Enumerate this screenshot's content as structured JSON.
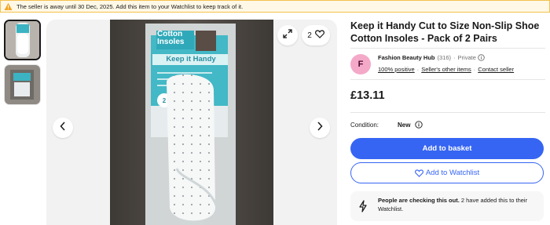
{
  "notice": {
    "text": "The seller is away until 30 Dec, 2025. Add this item to your Watchlist to keep track of it.",
    "icon": "warning-icon",
    "border_color": "#f5c14f",
    "background_color": "#fff8e6"
  },
  "gallery": {
    "thumbnail_count": 2,
    "watch_count": "2",
    "package_text": {
      "brand_line1": "Cotton",
      "brand_line2": "Insoles",
      "slogan": "Keep it Handy",
      "pairs": "2"
    },
    "icons": {
      "expand": "expand-icon",
      "heart": "heart-icon",
      "prev": "chevron-left-icon",
      "next": "chevron-right-icon"
    }
  },
  "listing": {
    "title": "Keep it Handy Cut to Size Non-Slip Shoe Cotton Insoles - Pack of 2 Pairs",
    "price": "£13.11",
    "condition_label": "Condition:",
    "condition_value": "New"
  },
  "seller": {
    "avatar_letter": "F",
    "avatar_color": "#f4a9c9",
    "name": "Fashion Beauty Hub",
    "feedback_count": "(316)",
    "type": "Private",
    "positive": "100% positive",
    "other_items": "Seller's other items",
    "contact": "Contact seller"
  },
  "actions": {
    "buy_label": "Add to basket",
    "watch_label": "Add to Watchlist",
    "primary_color": "#3665f3"
  },
  "signal": {
    "bold_text": "People are checking this out.",
    "rest_text": " 2 have added this to their Watchlist."
  }
}
